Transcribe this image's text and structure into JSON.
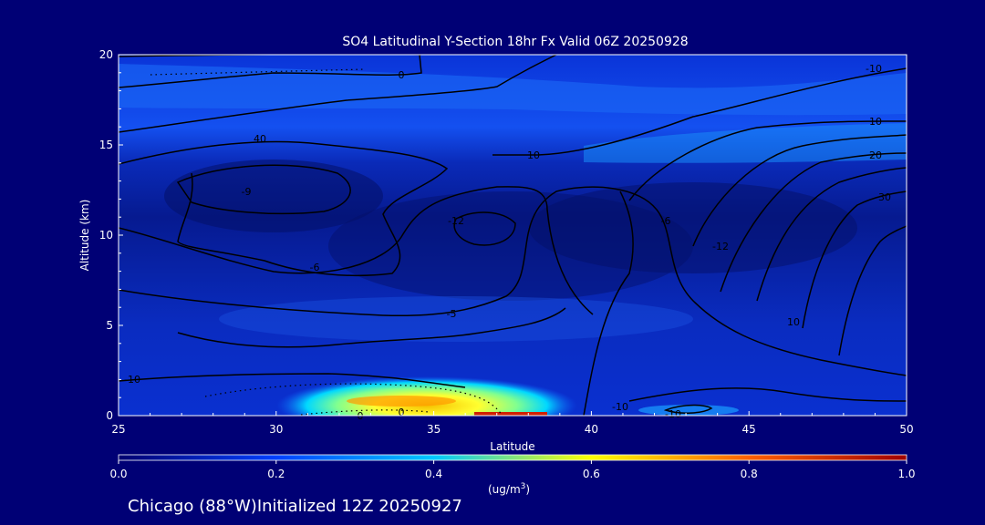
{
  "chart_data": {
    "type": "heatmap",
    "title": "SO4 Latitudinal Y-Section 18hr  Fx Valid 06Z 20250928",
    "xlabel": "Latitude",
    "ylabel": "Altitude (km)",
    "xlim": [
      25,
      50
    ],
    "ylim": [
      0,
      20
    ],
    "x_ticks": [
      "25",
      "30",
      "35",
      "40",
      "45",
      "50"
    ],
    "y_ticks": [
      "0",
      "5",
      "10",
      "15",
      "20"
    ],
    "colorbar": {
      "min": 0.0,
      "max": 1.0,
      "ticks": [
        "0.0",
        "0.2",
        "0.4",
        "0.6",
        "0.8",
        "1.0"
      ],
      "unit": "(ug/m",
      "unit_exp": "3",
      "unit_close": ")",
      "colors": [
        "#000070",
        "#0040ff",
        "#00c8ff",
        "#ffff00",
        "#ff6000",
        "#a00000"
      ]
    },
    "contour_labels": [
      "0",
      "-10",
      "10",
      "10",
      "20",
      "30",
      "40",
      "-9",
      "-12",
      "-6",
      "-12",
      "-6",
      "-5",
      "10",
      "0",
      "-10",
      "-10",
      "-10",
      "0"
    ],
    "approx_field": [
      {
        "lat": 25,
        "alt": 18,
        "value": 0.18
      },
      {
        "lat": 37.5,
        "alt": 17,
        "value": 0.16
      },
      {
        "lat": 45,
        "alt": 16,
        "value": 0.22
      },
      {
        "lat": 30,
        "alt": 12,
        "value": 0.08
      },
      {
        "lat": 45,
        "alt": 10,
        "value": 0.06
      },
      {
        "lat": 35,
        "alt": 5,
        "value": 0.12
      },
      {
        "lat": 34.5,
        "alt": 0.8,
        "value": 0.56
      },
      {
        "lat": 36.5,
        "alt": 0.3,
        "value": 0.7
      },
      {
        "lat": 43,
        "alt": 0.5,
        "value": 0.18
      }
    ]
  },
  "footer": {
    "city": "Chicago (88°W)",
    "initialized": "Initialized 12Z 20250927"
  }
}
